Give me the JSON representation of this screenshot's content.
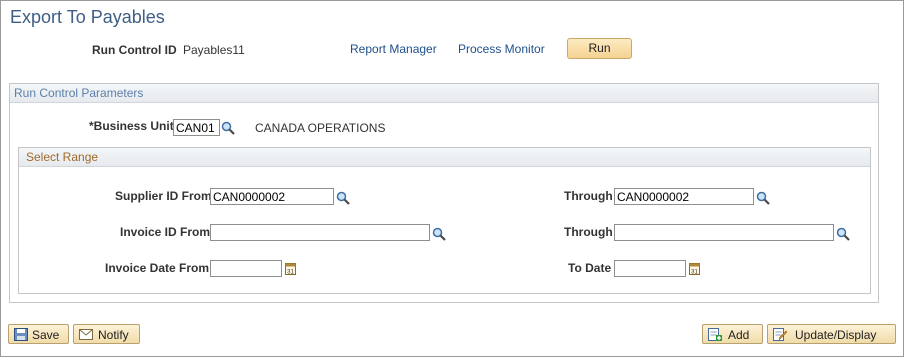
{
  "page": {
    "title": "Export To Payables"
  },
  "header": {
    "run_control_label": "Run Control ID",
    "run_control_value": "Payables11",
    "report_manager": "Report Manager",
    "process_monitor": "Process Monitor",
    "run_label": "Run"
  },
  "params": {
    "section_title": "Run Control Parameters",
    "business_unit_label": "*Business Unit",
    "business_unit_value": "CAN01",
    "business_unit_desc": "CANADA OPERATIONS"
  },
  "range": {
    "section_title": "Select Range",
    "supplier_from_label": "Supplier ID From",
    "supplier_from_value": "CAN0000002",
    "supplier_through_label": "Through",
    "supplier_through_value": "CAN0000002",
    "invoice_from_label": "Invoice ID From",
    "invoice_from_value": "",
    "invoice_through_label": "Through",
    "invoice_through_value": "",
    "date_from_label": "Invoice Date From",
    "date_from_value": "",
    "date_to_label": "To Date",
    "date_to_value": ""
  },
  "footer": {
    "save_label": "Save",
    "notify_label": "Notify",
    "add_label": "Add",
    "update_label": "Update/Display"
  },
  "colors": {
    "title": "#3d5e85",
    "link": "#1f4f8c",
    "group_title_params": "#5a7fa8",
    "group_title_range": "#a06a2a",
    "button_fill": "#f5d291"
  },
  "icons": [
    "lookup-icon",
    "calendar-icon",
    "save-icon",
    "notify-icon",
    "add-icon",
    "update-display-icon"
  ]
}
